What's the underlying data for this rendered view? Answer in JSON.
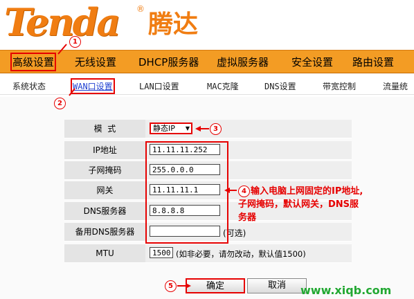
{
  "brand": {
    "logo_text": "Tenda",
    "logo_cn": "腾达",
    "reg_mark": "®"
  },
  "main_nav": [
    {
      "label": "高级设置"
    },
    {
      "label": "无线设置"
    },
    {
      "label": "DHCP服务器"
    },
    {
      "label": "虚拟服务器"
    },
    {
      "label": "安全设置"
    },
    {
      "label": "路由设置"
    }
  ],
  "sub_nav": [
    {
      "label": "系统状态"
    },
    {
      "label": "WAN口设置"
    },
    {
      "label": "LAN口设置"
    },
    {
      "label": "MAC克隆"
    },
    {
      "label": "DNS设置"
    },
    {
      "label": "带宽控制"
    },
    {
      "label": "流量统"
    }
  ],
  "form": {
    "mode_label": "模  式",
    "mode_value": "静态IP",
    "ip_label": "IP地址",
    "ip_value": "11.11.11.252",
    "mask_label": "子网掩码",
    "mask_value": "255.0.0.0",
    "gw_label": "网关",
    "gw_value": "11.11.11.1",
    "dns_label": "DNS服务器",
    "dns_value": "8.8.8.8",
    "dns2_label": "备用DNS服务器",
    "dns2_value": "",
    "dns2_hint": "(可选)",
    "mtu_label": "MTU",
    "mtu_value": "1500",
    "mtu_hint": "(如非必要，请勿改动，默认值1500)"
  },
  "buttons": {
    "ok": "确定",
    "cancel": "取消"
  },
  "annotations": {
    "n1": "1",
    "n2": "2",
    "n3": "3",
    "n4": "4",
    "n5": "5",
    "note_line1": "输入电脑上网固定的IP地址,",
    "note_line2": "子网掩码，默认网关，DNS服",
    "note_line3": "务器"
  },
  "watermark": "www.xiqb.com",
  "colors": {
    "nav_bg": "#f39c24",
    "brand": "#f07d12",
    "annotation": "#e60000",
    "watermark": "#22a832"
  }
}
